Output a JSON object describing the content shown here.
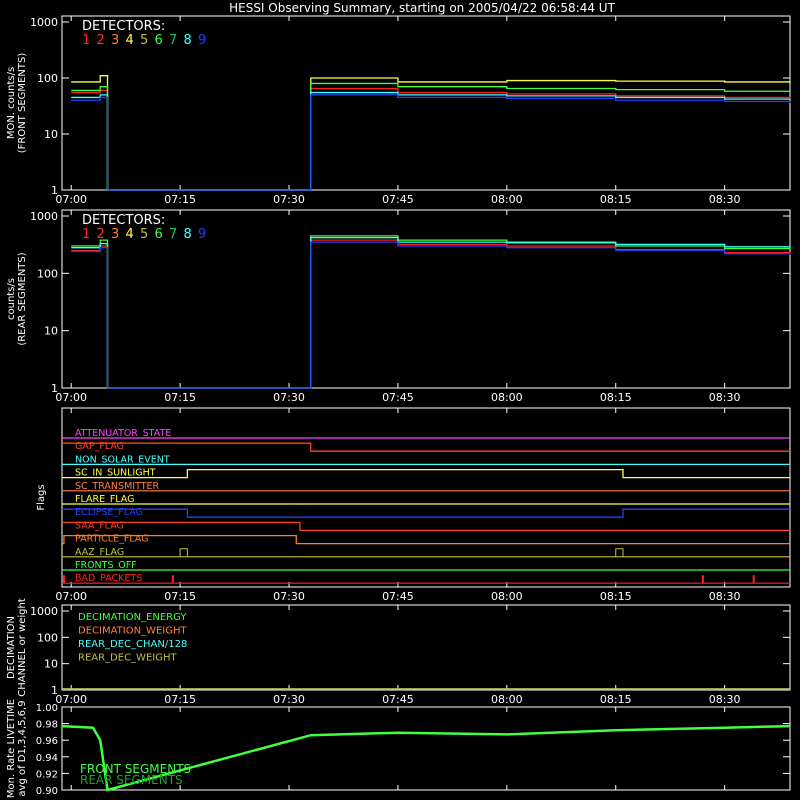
{
  "title": "HESSI Observing Summary, starting on 2005/04/22 06:58:44 UT",
  "colors": {
    "background": "#000000",
    "axes": "#ffffff",
    "detectors": [
      "#ff2020",
      "#ff3030",
      "#ff8040",
      "#ffff40",
      "#c0c040",
      "#40ff40",
      "#20c060",
      "#40ffff",
      "#2040ff"
    ]
  },
  "x_ticks": [
    "07:00",
    "07:15",
    "07:30",
    "07:45",
    "08:00",
    "08:15",
    "08:30"
  ],
  "detectors_label": "DETECTORS:",
  "detector_numbers": [
    "1",
    "2",
    "3",
    "4",
    "5",
    "6",
    "7",
    "8",
    "9"
  ],
  "panels": {
    "front": {
      "ylabel1": "MON. counts/s",
      "ylabel2": "(FRONT SEGMENTS)",
      "yticks": [
        "1",
        "10",
        "100",
        "1000"
      ]
    },
    "rear": {
      "ylabel1": "counts/s",
      "ylabel2": "(REAR SEGMENTS)",
      "yticks": [
        "1",
        "10",
        "100",
        "1000"
      ]
    },
    "flags": {
      "ylabel": "Flags",
      "items": [
        {
          "label": "ATTENUATOR_STATE",
          "color": "#ff40ff"
        },
        {
          "label": "GAP_FLAG",
          "color": "#ff4020"
        },
        {
          "label": "NON_SOLAR_EVENT",
          "color": "#40ffff"
        },
        {
          "label": "SC_IN_SUNLIGHT",
          "color": "#ffff40"
        },
        {
          "label": "SC_TRANSMITTER",
          "color": "#ff8040"
        },
        {
          "label": "FLARE_FLAG",
          "color": "#ffff40"
        },
        {
          "label": "ECLIPSE_FLAG",
          "color": "#2040ff"
        },
        {
          "label": "SAA_FLAG",
          "color": "#ff4020"
        },
        {
          "label": "PARTICLE_FLAG",
          "color": "#ff8020"
        },
        {
          "label": "AAZ_FLAG",
          "color": "#c0c040"
        },
        {
          "label": "FRONTS_OFF",
          "color": "#40ff40"
        },
        {
          "label": "BAD_PACKETS",
          "color": "#ff2020"
        }
      ]
    },
    "decimation": {
      "ylabel1": "DECIMATION",
      "ylabel2": "CHANNEL or weight",
      "yticks": [
        "1",
        "10",
        "100",
        "1000"
      ],
      "legend": [
        {
          "label": "DECIMATION_ENERGY",
          "color": "#40ff40"
        },
        {
          "label": "DECIMATION_WEIGHT",
          "color": "#ff8040"
        },
        {
          "label": "REAR_DEC_CHAN/128",
          "color": "#40ffff"
        },
        {
          "label": "REAR_DEC_WEIGHT",
          "color": "#c0c040"
        }
      ]
    },
    "livetime": {
      "ylabel1": "Mon. Rate LIVETIME",
      "ylabel2": "avg of D1,3,4,5,6,9",
      "yticks": [
        "0.90",
        "0.92",
        "0.94",
        "0.96",
        "0.98",
        "1.00"
      ],
      "legend": [
        {
          "label": "FRONT SEGMENTS",
          "color": "#40ff40"
        },
        {
          "label": "REAR SEGMENTS",
          "color": "#20a030"
        }
      ]
    }
  },
  "chart_data": [
    {
      "type": "line",
      "title": "HESSI Observing Summary, starting on 2005/04/22 06:58:44 UT",
      "ylabel": "MON. counts/s (FRONT SEGMENTS)",
      "yscale": "log",
      "ylim": [
        1,
        1000
      ],
      "xlim": [
        "06:58:44",
        "08:39:00"
      ],
      "series": [
        {
          "name": "1",
          "x": [
            "07:00",
            "07:04",
            "07:05",
            "07:33",
            "07:45",
            "08:00",
            "08:15",
            "08:30",
            "08:39"
          ],
          "y": [
            55,
            60,
            1,
            65,
            55,
            52,
            48,
            45,
            42
          ]
        },
        {
          "name": "4",
          "x": [
            "07:00",
            "07:04",
            "07:05",
            "07:33",
            "07:45",
            "08:00",
            "08:15",
            "08:30",
            "08:39"
          ],
          "y": [
            85,
            110,
            1,
            100,
            85,
            90,
            88,
            85,
            80
          ]
        },
        {
          "name": "6",
          "x": [
            "07:00",
            "07:04",
            "07:05",
            "07:33",
            "07:45",
            "08:00",
            "08:15",
            "08:30",
            "08:39"
          ],
          "y": [
            60,
            70,
            1,
            80,
            70,
            65,
            62,
            58,
            55
          ]
        },
        {
          "name": "8",
          "x": [
            "07:00",
            "07:04",
            "07:05",
            "07:33",
            "07:45",
            "08:00",
            "08:15",
            "08:30",
            "08:39"
          ],
          "y": [
            45,
            50,
            1,
            55,
            50,
            48,
            45,
            42,
            40
          ]
        },
        {
          "name": "9",
          "x": [
            "07:00",
            "07:04",
            "07:05",
            "07:33",
            "07:45",
            "08:00",
            "08:15",
            "08:30",
            "08:39"
          ],
          "y": [
            40,
            45,
            1,
            50,
            45,
            43,
            40,
            38,
            36
          ]
        }
      ]
    },
    {
      "type": "line",
      "ylabel": "counts/s (REAR SEGMENTS)",
      "yscale": "log",
      "ylim": [
        1,
        1000
      ],
      "series": [
        {
          "name": "1",
          "x": [
            "07:00",
            "07:04",
            "07:05",
            "07:33",
            "07:45",
            "08:00",
            "08:15",
            "08:30",
            "08:39"
          ],
          "y": [
            250,
            300,
            1,
            380,
            320,
            300,
            260,
            230,
            220
          ]
        },
        {
          "name": "6",
          "x": [
            "07:00",
            "07:04",
            "07:05",
            "07:33",
            "07:45",
            "08:00",
            "08:15",
            "08:30",
            "08:39"
          ],
          "y": [
            300,
            380,
            1,
            450,
            380,
            350,
            300,
            270,
            260
          ]
        },
        {
          "name": "8",
          "x": [
            "07:00",
            "07:04",
            "07:05",
            "07:33",
            "07:45",
            "08:00",
            "08:15",
            "08:30",
            "08:39"
          ],
          "y": [
            280,
            330,
            1,
            420,
            350,
            340,
            320,
            290,
            280
          ]
        },
        {
          "name": "9",
          "x": [
            "07:00",
            "07:04",
            "07:05",
            "07:33",
            "07:45",
            "08:00",
            "08:15",
            "08:30",
            "08:39"
          ],
          "y": [
            240,
            280,
            1,
            350,
            300,
            280,
            250,
            220,
            210
          ]
        }
      ]
    },
    {
      "type": "line",
      "ylabel": "Flags",
      "series": [
        {
          "name": "GAP_FLAG",
          "x": [
            "06:58:44",
            "07:32",
            "07:33",
            "08:39"
          ],
          "y": [
            1,
            1,
            0,
            0
          ]
        },
        {
          "name": "SC_IN_SUNLIGHT",
          "x": [
            "06:58:44",
            "07:15:30",
            "07:16",
            "08:15",
            "08:16",
            "08:39"
          ],
          "y": [
            0,
            0,
            1,
            1,
            0,
            0
          ]
        },
        {
          "name": "ECLIPSE_FLAG",
          "x": [
            "06:58:44",
            "07:15:30",
            "07:16",
            "08:15",
            "08:16",
            "08:39"
          ],
          "y": [
            1,
            1,
            0,
            0,
            1,
            1
          ]
        },
        {
          "name": "SAA_FLAG",
          "x": [
            "06:58:44",
            "07:31",
            "07:31:30",
            "08:39"
          ],
          "y": [
            1,
            1,
            0,
            0
          ]
        },
        {
          "name": "PARTICLE_FLAG",
          "x": [
            "06:58:44",
            "06:59",
            "07:30",
            "07:31",
            "08:39"
          ],
          "y": [
            0,
            1,
            1,
            0,
            0
          ]
        },
        {
          "name": "AAZ_FLAG",
          "x": [
            "07:15",
            "07:16",
            "08:15",
            "08:16"
          ],
          "y": [
            1,
            0,
            1,
            0
          ]
        },
        {
          "name": "BAD_PACKETS",
          "x": [
            "06:59",
            "07:14",
            "08:27",
            "08:34"
          ],
          "y": [
            1,
            1,
            1,
            1
          ]
        }
      ]
    },
    {
      "type": "line",
      "ylabel": "DECIMATION CHANNEL or weight",
      "yscale": "log",
      "ylim": [
        1,
        1000
      ],
      "series": [
        {
          "name": "DECIMATION_ENERGY",
          "x": [
            "06:58:44",
            "08:39"
          ],
          "y": [
            1,
            1
          ]
        },
        {
          "name": "DECIMATION_WEIGHT",
          "x": [
            "06:58:44",
            "08:39"
          ],
          "y": [
            1,
            1
          ]
        },
        {
          "name": "REAR_DEC_CHAN/128",
          "x": [
            "06:58:44",
            "08:39"
          ],
          "y": [
            1,
            1
          ]
        },
        {
          "name": "REAR_DEC_WEIGHT",
          "x": [
            "06:58:44",
            "08:39"
          ],
          "y": [
            1,
            1
          ]
        }
      ]
    },
    {
      "type": "line",
      "ylabel": "Mon. Rate LIVETIME avg of D1,3,4,5,6,9",
      "ylim": [
        0.9,
        1.0
      ],
      "series": [
        {
          "name": "FRONT SEGMENTS",
          "x": [
            "06:58:44",
            "07:03",
            "07:04",
            "07:05",
            "07:33",
            "07:45",
            "08:00",
            "08:15",
            "08:30",
            "08:39"
          ],
          "y": [
            0.977,
            0.975,
            0.96,
            0.9,
            0.966,
            0.969,
            0.967,
            0.972,
            0.975,
            0.977
          ]
        }
      ]
    }
  ]
}
